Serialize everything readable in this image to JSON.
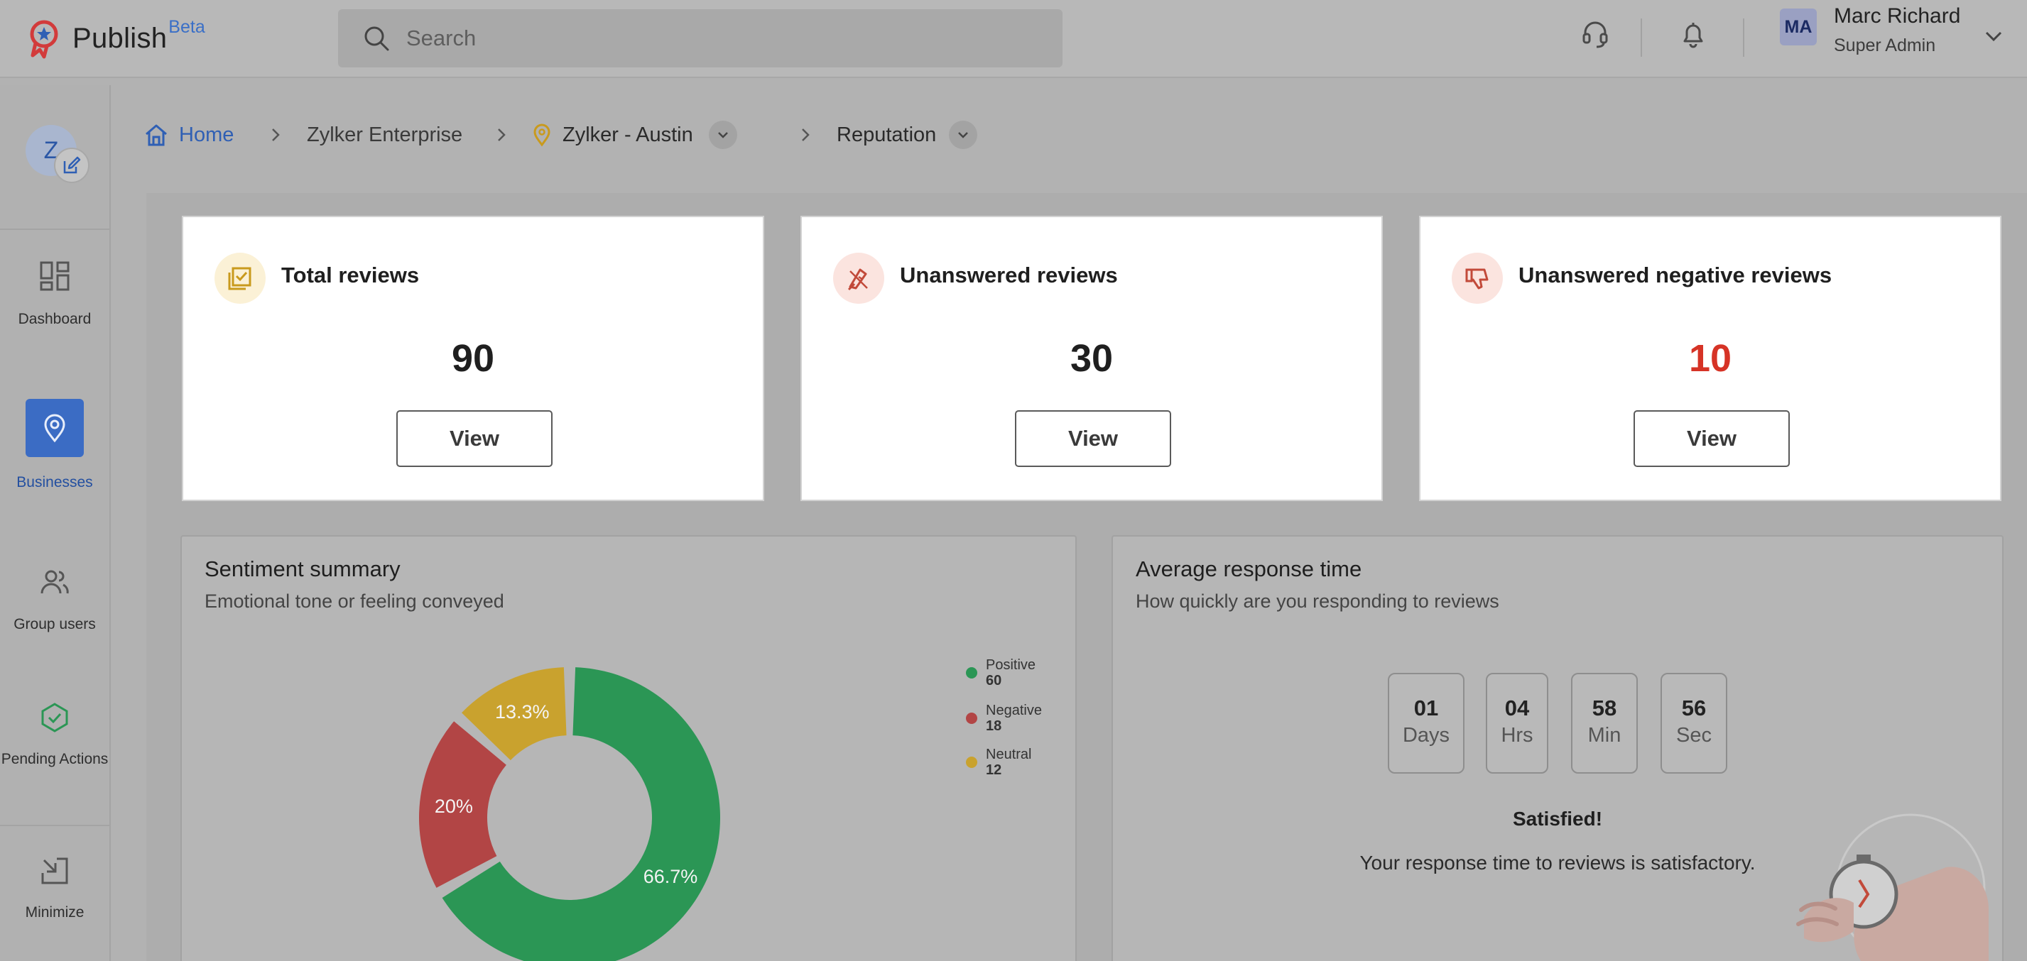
{
  "app": {
    "name": "Publish",
    "badge": "Beta"
  },
  "search": {
    "placeholder": "Search"
  },
  "user": {
    "initials": "MA",
    "name": "Marc Richard",
    "role": "Super Admin"
  },
  "business": {
    "initial": "Z"
  },
  "nav": [
    {
      "label": "Dashboard",
      "icon": "dashboard-icon",
      "active": false
    },
    {
      "label": "Businesses",
      "icon": "location-pin-icon",
      "active": true
    },
    {
      "label": "Group users",
      "icon": "group-users-icon",
      "active": false
    },
    {
      "label": "Pending Actions",
      "icon": "shield-check-icon",
      "active": false
    },
    {
      "label": "Minimize",
      "icon": "minimize-icon",
      "active": false
    }
  ],
  "breadcrumb": {
    "home": "Home",
    "enterprise": "Zylker Enterprise",
    "location": "Zylker - Austin",
    "page": "Reputation"
  },
  "stats": [
    {
      "title": "Total reviews",
      "value": "90",
      "button": "View",
      "icon": "checklist-icon",
      "icon_color": "#c99a1d"
    },
    {
      "title": "Unanswered reviews",
      "value": "30",
      "button": "View",
      "icon": "quill-icon",
      "icon_color": "#c24a3a"
    },
    {
      "title": "Unanswered negative reviews",
      "value": "10",
      "button": "View",
      "icon": "thumbs-down-icon",
      "icon_color": "#c24a3a"
    }
  ],
  "sentiment": {
    "title": "Sentiment summary",
    "subtitle": "Emotional tone or feeling conveyed"
  },
  "chart_data": {
    "type": "pie",
    "donut": true,
    "categories": [
      "Positive",
      "Negative",
      "Neutral"
    ],
    "values": [
      60,
      18,
      12
    ],
    "percent_labels": [
      "66.7%",
      "20%",
      "13.3%"
    ],
    "colors": [
      "#2b9655",
      "#b24545",
      "#c9a22e"
    ],
    "legend_placement": "right"
  },
  "response": {
    "title": "Average response time",
    "subtitle": "How quickly are you responding to reviews",
    "units": [
      {
        "value": "01",
        "label": "Days"
      },
      {
        "value": "04",
        "label": "Hrs"
      },
      {
        "value": "58",
        "label": "Min"
      },
      {
        "value": "56",
        "label": "Sec"
      }
    ],
    "status": "Satisfied!",
    "message": "Your response time to reviews is satisfactory."
  },
  "colors": {
    "accent": "#3b6cc4",
    "negative_value": "#d63326"
  }
}
